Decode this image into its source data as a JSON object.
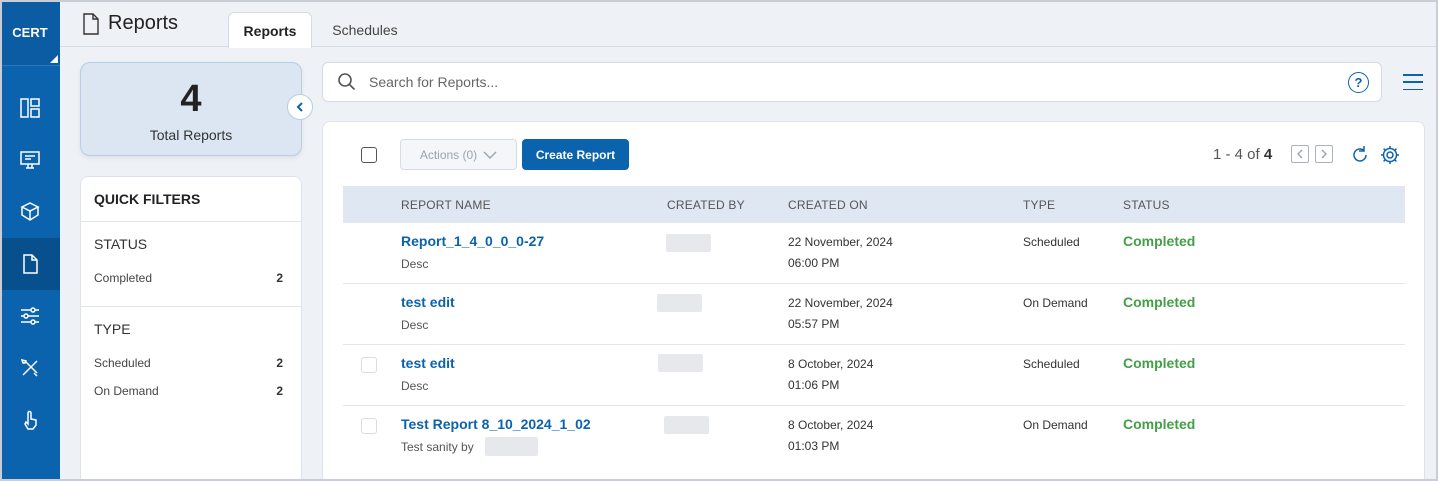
{
  "brand": "CERT",
  "nav": [
    {
      "icon": "dashboard-icon"
    },
    {
      "icon": "monitor-icon"
    },
    {
      "icon": "cube-icon"
    },
    {
      "icon": "document-icon"
    },
    {
      "icon": "sliders-icon"
    },
    {
      "icon": "tools-icon"
    },
    {
      "icon": "hand-pointer-icon"
    }
  ],
  "header": {
    "title": "Reports",
    "tabs": [
      {
        "label": "Reports",
        "active": true
      },
      {
        "label": "Schedules",
        "active": false
      }
    ]
  },
  "summary": {
    "count": "4",
    "label": "Total Reports"
  },
  "quick_filters": {
    "title": "QUICK FILTERS",
    "status": {
      "heading": "STATUS",
      "items": [
        {
          "label": "Completed",
          "count": "2"
        }
      ]
    },
    "type": {
      "heading": "TYPE",
      "items": [
        {
          "label": "Scheduled",
          "count": "2"
        },
        {
          "label": "On Demand",
          "count": "2"
        }
      ]
    }
  },
  "search": {
    "placeholder": "Search for Reports...",
    "help": "?"
  },
  "toolbar": {
    "actions_label": "Actions (0)",
    "create_label": "Create Report",
    "pager_range": "1 - 4 of",
    "pager_total": "4"
  },
  "table": {
    "columns": [
      "REPORT NAME",
      "CREATED BY",
      "CREATED ON",
      "TYPE",
      "STATUS"
    ],
    "rows": [
      {
        "name": "Report_1_4_0_0_0-27",
        "desc": "Desc",
        "date": "22 November, 2024",
        "time": "06:00 PM",
        "type": "Scheduled",
        "status": "Completed"
      },
      {
        "name": "test edit",
        "desc": "Desc",
        "date": "22 November, 2024",
        "time": "05:57 PM",
        "type": "On Demand",
        "status": "Completed"
      },
      {
        "name": "test edit",
        "desc": "Desc",
        "date": "8 October, 2024",
        "time": "01:06 PM",
        "type": "Scheduled",
        "status": "Completed"
      },
      {
        "name": "Test Report 8_10_2024_1_02",
        "desc": "Test sanity by",
        "date": "8 October, 2024",
        "time": "01:03 PM",
        "type": "On Demand",
        "status": "Completed"
      }
    ]
  },
  "colors": {
    "primary": "#0c63ad",
    "success": "#43a047",
    "header_bg": "#dfe8f2"
  }
}
